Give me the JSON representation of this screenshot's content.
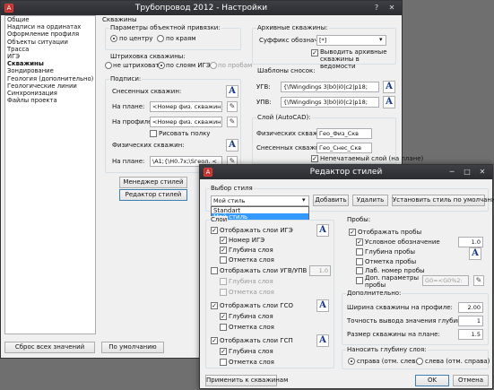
{
  "settings": {
    "title": "Трубопровод 2012 - Настройки",
    "nav": [
      "Общие",
      "Надписи на ординатах",
      "Оформление профиля",
      "Объекты ситуации",
      "Трасса",
      "ИГЭ",
      "Скважины",
      "Зондирование",
      "Геология (дополнительно)",
      "Геологические линии",
      "Синхронизация",
      "Файлы проекта"
    ],
    "section_title": "Скважины",
    "binding": {
      "label": "Параметры объектной привязки:",
      "center": "по центру",
      "edge": "по краям"
    },
    "hatching": {
      "label": "Штриховка скважины:",
      "none": "не штриховать",
      "by_layers": "по слоям ИГЭ",
      "by_samples": "по пробам"
    },
    "labels": {
      "label": "Подписи:",
      "removed": "Снесенных скважин:",
      "on_plan": "На плане:",
      "on_plan_value": "<Номер физ. скважины>",
      "on_profile": "На профиле:",
      "on_profile_value": "<Номер физ. скважины>",
      "draw_shelf": "Рисовать полку",
      "physical": "Физических скважин:",
      "physical_plan": "На плане:",
      "physical_plan_value": "\\A1;{\\H0.7x;\\Sгеол. <"
    },
    "archive": {
      "label": "Архивные скважины:",
      "suffix_label": "Суффикс обозначения:",
      "suffix_value": "[*]",
      "show_archive": "Выводить архивные скважины в ведомости"
    },
    "fonts": {
      "label": "Шаблоны сносок:",
      "ugv_label": "УГВ:",
      "ugv_value": "{\\fWingdings 3|b0|i0|c2|p18;",
      "upv_label": "УПВ:",
      "upv_value": "{\\fWingdings 3|b0|i0|c2|p18;"
    },
    "layer": {
      "label": "Слой (AutoCAD):",
      "physical_label": "Физических скважин:",
      "physical_value": "Гео_Физ_Скв",
      "removed_label": "Снесенных скважин:",
      "removed_value": "Гео_Снес_Скв",
      "non_print": "Непечатаемый слой (на плане)"
    },
    "style_manager_btn": "Менеджер стилей",
    "style_editor_btn": "Редактор стилей",
    "reset_btn": "Сброс всех значений",
    "default_btn": "По умолчанию"
  },
  "editor": {
    "title": "Редактор стилей",
    "style_group": "Выбор стиля",
    "style_value": "Мой стиль",
    "style_options": [
      "Standart",
      "Мой стиль"
    ],
    "add_btn": "Добавить",
    "delete_btn": "Удалить",
    "set_default_btn": "Установить стиль по умолчанию",
    "layers_label": "Слои",
    "show_ige": "Отображать слои ИГЭ",
    "ige_number": "Номер ИГЭ",
    "layer_depth": "Глубина слоя",
    "layer_mark": "Отметка слоя",
    "show_ugv": "Отображать слои УГВ/УПВ",
    "ugv_value": "1.0",
    "show_gso": "Отображать слои ГСО",
    "show_gsp": "Отображать слои ГСП",
    "apply_btn": "Применить к скважинам",
    "samples_label": "Пробы:",
    "show_samples": "Отображать пробы",
    "symbol": "Условное обозначение",
    "symbol_value": "1.0",
    "sample_depth": "Глубина пробы",
    "sample_mark": "Отметка пробы",
    "lab_number": "Лаб. номер пробы",
    "extra_params": "Доп. параметры пробы",
    "extra_value": "G0=<G0%2:",
    "additional_label": "Дополнительно:",
    "width_label": "Ширина скважины на профиле:",
    "width_value": "2.00",
    "precision_label": "Точность вывода значения глубины:",
    "precision_value": "1",
    "plan_size_label": "Размер скважины на плане:",
    "plan_size_value": "1.5",
    "depth_apply_label": "Наносить глубину слоя:",
    "right_opt": "справа (отм. слева)",
    "left_opt": "слева (отм. справа)",
    "ok_btn": "OK",
    "cancel_btn": "Отмена"
  }
}
